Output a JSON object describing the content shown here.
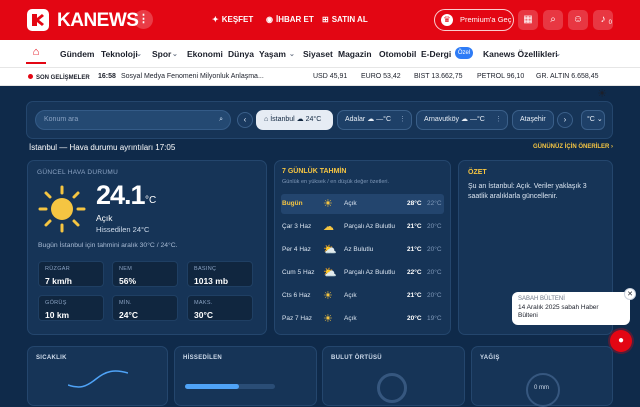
{
  "header": {
    "brand": "KANEWS",
    "more_icon": "kebab-icon",
    "links": [
      {
        "label": "KEŞFET",
        "icon": "sparkle-icon"
      },
      {
        "label": "İHBAR ET",
        "icon": "megaphone-icon"
      },
      {
        "label": "SATIN AL",
        "icon": "cart-icon"
      }
    ],
    "premium": "Premium'a Geç",
    "icons": [
      "grid-icon",
      "search-icon",
      "user-icon",
      "bell-icon"
    ],
    "notif_count": "0",
    "accent": "#e30613"
  },
  "nav": {
    "items": [
      "Gündem",
      "Teknoloji",
      "Spor",
      "Ekonomi",
      "Dünya",
      "Yaşam",
      "Siyaset",
      "Magazin",
      "Otomobil",
      "E-Dergi",
      "Kanews Özellikleri"
    ],
    "badge": "Özel",
    "home_icon": "home-icon",
    "theme_icon": "sun-icon"
  },
  "ticker": {
    "label": "SON GELİŞMELER",
    "time": "16:58",
    "headline": "Sosyal Medya Fenomeni Milyonluk Anlaşma...",
    "markets": [
      "USD 45,91",
      "EURO 53,42",
      "BIST 13.662,75",
      "PETROL 96,10",
      "GR. ALTIN 6.658,45"
    ]
  },
  "toolbar": {
    "search_placeholder": "Konum ara",
    "cities": [
      {
        "name": "İstanbul",
        "temp": "24°C",
        "active": true
      },
      {
        "name": "Adalar",
        "temp": "—°C",
        "active": false
      },
      {
        "name": "Arnavutköy",
        "temp": "—°C",
        "active": false
      },
      {
        "name": "Ataşehir",
        "temp": "",
        "active": false
      }
    ],
    "unit": "°C"
  },
  "page": {
    "title": "İstanbul — Hava durumu ayrıntıları 17:05",
    "link": "GÜNÜNÜZ İÇİN ÖNERİLER ›"
  },
  "current": {
    "label": "GÜNCEL HAVA DURUMU",
    "temp": "24.1",
    "unit": "°C",
    "condition": "Açık",
    "feels": "Hissedilen 24°C",
    "range": "Bugün İstanbul için tahmini aralık 30°C / 24°C.",
    "stats": [
      {
        "k": "RÜZGAR",
        "v": "7 km/h"
      },
      {
        "k": "NEM",
        "v": "56%"
      },
      {
        "k": "BASINÇ",
        "v": "1013 mb"
      },
      {
        "k": "GÖRÜŞ",
        "v": "10 km"
      },
      {
        "k": "MİN.",
        "v": "24°C"
      },
      {
        "k": "MAKS.",
        "v": "30°C"
      }
    ]
  },
  "forecast": {
    "label": "7 GÜNLÜK TAHMİN",
    "sub": "Günlük en yüksek / en düşük değer özetleri.",
    "days": [
      {
        "day": "Bugün",
        "icon": "sun-icon",
        "desc": "Açık",
        "hi": "28°C",
        "lo": "22°C"
      },
      {
        "day": "Çar 3 Haz",
        "icon": "cloud-icon",
        "desc": "Parçalı Az Bulutlu",
        "hi": "21°C",
        "lo": "20°C"
      },
      {
        "day": "Per 4 Haz",
        "icon": "partly-cloudy-icon",
        "desc": "Az Bulutlu",
        "hi": "21°C",
        "lo": "20°C"
      },
      {
        "day": "Cum 5 Haz",
        "icon": "partly-cloudy-icon",
        "desc": "Parçalı Az Bulutlu",
        "hi": "22°C",
        "lo": "20°C"
      },
      {
        "day": "Cts 6 Haz",
        "icon": "sun-icon",
        "desc": "Açık",
        "hi": "21°C",
        "lo": "20°C"
      },
      {
        "day": "Paz 7 Haz",
        "icon": "sun-icon",
        "desc": "Açık",
        "hi": "20°C",
        "lo": "19°C"
      }
    ]
  },
  "summary": {
    "label": "ÖZET",
    "text": "Şu an İstanbul: Açık. Veriler yaklaşık 3 saatlik aralıklarla güncellenir."
  },
  "toast": {
    "kicker": "SABAH BÜLTENİ",
    "text": "14 Aralık 2025 sabah Haber Bülteni"
  },
  "bottom": {
    "labels": [
      "SICAKLIK",
      "HİSSEDİLEN",
      "BULUT ÖRTÜSÜ",
      "YAĞIŞ"
    ],
    "feels_fill": 0.6,
    "precip": "0 mm"
  }
}
